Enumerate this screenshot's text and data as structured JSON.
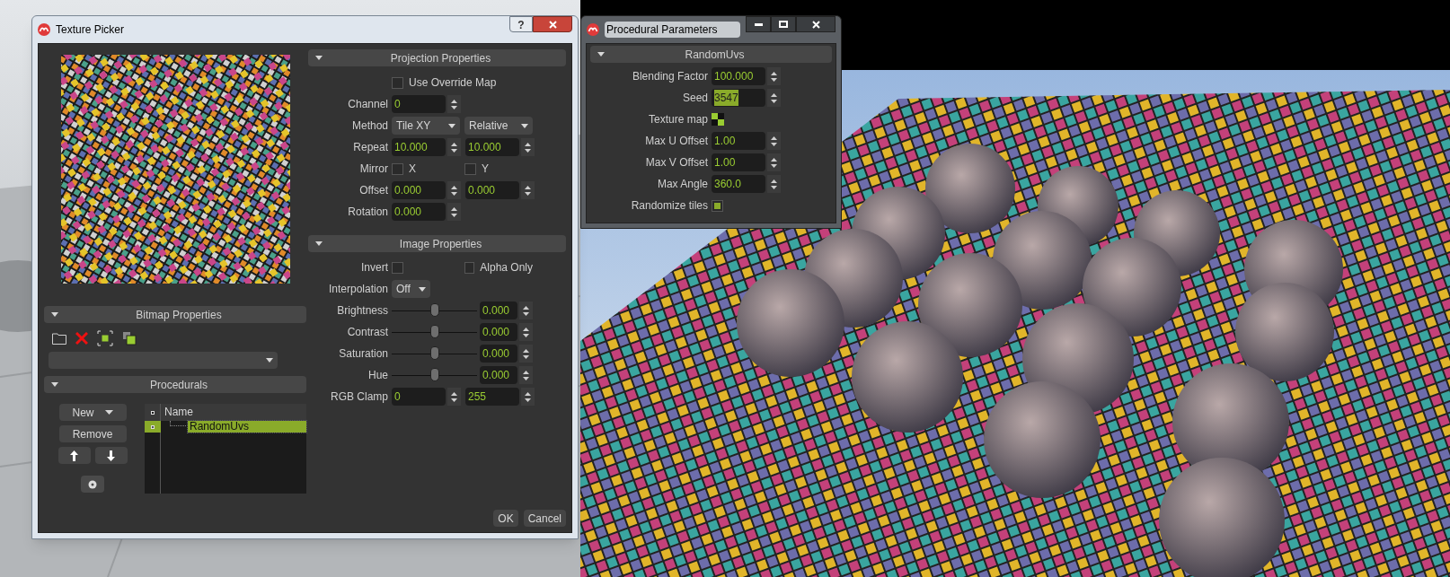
{
  "texture_picker": {
    "title": "Texture Picker",
    "help_button": "?",
    "bitmap_properties": {
      "title": "Bitmap Properties",
      "expanded": true
    },
    "procedurals": {
      "title": "Procedurals",
      "expanded": true,
      "new_button": "New",
      "remove_button": "Remove",
      "tree": {
        "column": "Name",
        "rows": [
          {
            "name": "RandomUvs",
            "selected": true
          }
        ]
      }
    },
    "projection_properties": {
      "title": "Projection Properties",
      "expanded": true,
      "rows": [
        {
          "kind": "checkbox",
          "label": "Use Override Map",
          "checked": false
        },
        {
          "kind": "spin",
          "label": "Channel",
          "values": [
            "0"
          ]
        },
        {
          "kind": "dropdown",
          "label": "Method",
          "values": [
            "Tile XY",
            "Relative"
          ]
        },
        {
          "kind": "spin",
          "label": "Repeat",
          "values": [
            "10.000",
            "10.000"
          ]
        },
        {
          "kind": "checks",
          "label": "Mirror",
          "options": [
            {
              "label": "X",
              "checked": false
            },
            {
              "label": "Y",
              "checked": false
            }
          ]
        },
        {
          "kind": "spin",
          "label": "Offset",
          "values": [
            "0.000",
            "0.000"
          ]
        },
        {
          "kind": "spin",
          "label": "Rotation",
          "values": [
            "0.000"
          ]
        }
      ]
    },
    "image_properties": {
      "title": "Image Properties",
      "expanded": true,
      "rows": [
        {
          "kind": "checks",
          "label": "Invert",
          "options": [
            {
              "checked": false
            },
            {
              "label": "Alpha Only",
              "checked": false
            }
          ]
        },
        {
          "kind": "dropdown",
          "label": "Interpolation",
          "values": [
            "Off"
          ]
        },
        {
          "kind": "slider",
          "label": "Brightness",
          "level": 0.5,
          "value": "0.000"
        },
        {
          "kind": "slider",
          "label": "Contrast",
          "level": 0.5,
          "value": "0.000"
        },
        {
          "kind": "slider",
          "label": "Saturation",
          "level": 0.5,
          "value": "0.000"
        },
        {
          "kind": "slider",
          "label": "Hue",
          "level": 0.5,
          "value": "0.000"
        },
        {
          "kind": "spin",
          "label": "RGB Clamp",
          "values": [
            "0",
            "255"
          ]
        }
      ]
    },
    "buttons": [
      "OK",
      "Cancel"
    ]
  },
  "procedural_parameters": {
    "title": "Procedural Parameters",
    "section": {
      "title": "RandomUvs",
      "expanded": true,
      "rows": [
        {
          "kind": "spin",
          "label": "Blending Factor",
          "values": [
            "100.000"
          ],
          "highlighted": false
        },
        {
          "kind": "spin",
          "label": "Seed",
          "values": [
            "3547"
          ],
          "highlighted": true
        },
        {
          "kind": "map",
          "label": "Texture map"
        },
        {
          "kind": "spin",
          "label": "Max U Offset",
          "values": [
            "1.00"
          ],
          "highlighted": false
        },
        {
          "kind": "spin",
          "label": "Max V Offset",
          "values": [
            "1.00"
          ],
          "highlighted": false
        },
        {
          "kind": "spin",
          "label": "Max Angle",
          "values": [
            "360.0"
          ],
          "highlighted": false
        },
        {
          "kind": "checkbox",
          "label": "Randomize tiles",
          "checked": true
        }
      ]
    }
  }
}
